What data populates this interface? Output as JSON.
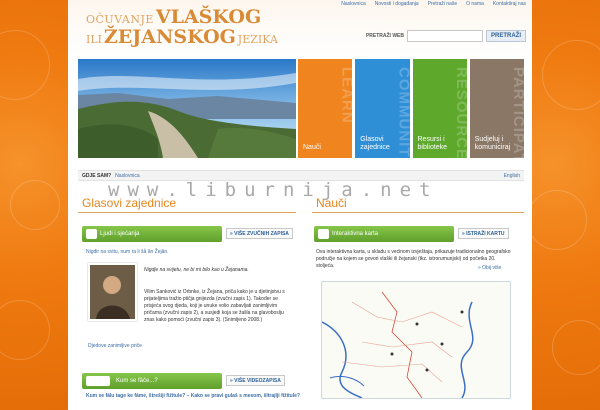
{
  "header": {
    "title_line1_small": "OČUVANJE",
    "title_line1_large": "VLAŠKOG",
    "title_line2_small1": "ILI",
    "title_line2_large": "ŽEJANSKOG",
    "title_line2_small2": "JEZIKA"
  },
  "topnav": [
    "Naslovnica",
    "Novosti i događanja",
    "Pretraži naše",
    "O nama",
    "Kontaktiraj nas"
  ],
  "search": {
    "label": "PRETRAŽI WEB",
    "button": "PRETRAŽI",
    "value": ""
  },
  "tiles": [
    {
      "label": "Nauči",
      "watermark": "LEARN",
      "color": "#f0841f"
    },
    {
      "label": "Glasovi zajednice",
      "watermark": "COMMUNITY",
      "color": "#2f8fd6"
    },
    {
      "label": "Resursi i biblioteke",
      "watermark": "RESOURCES",
      "color": "#5ea82b"
    },
    {
      "label": "Sudjeluj i komuniciraj",
      "watermark": "PARTICIPATE",
      "color": "#8a7765"
    }
  ],
  "breadcrumb": {
    "label": "GDJE SAM?",
    "link": "Naslovnica",
    "language": "English"
  },
  "watermark": "www.liburnija.net",
  "left": {
    "title": "Glasovi zajednice",
    "box1": {
      "title": "Ljudi i sjećanja",
      "more": "» VIŠE ZVUČNIH ZAPISA"
    },
    "intro": "Nigdir na svitu, num ra li šå ân Žejân.",
    "quote": "Nigdje na svijetu, ne bi mi bilo kao u Žejanama.",
    "body": "Vilim Sanković iz Orbnke, iz Žejana, priča kako je u djetinjstvu s prijateljima tražio ptičja gnijezda (zvučni zapis 1). Također se prisjeća svog djeda, koji je unuke volio zabavljati zanimljivim pričama (zvučni zapis 2), a susjedi koja se žalila na glavoboslju znas kako pomoći (zvučni zapis 3). (Snimljeno 2008.)",
    "more_link": "Djedove zanimljive priče",
    "box2": {
      "title": "Kum se fâče...?",
      "more": "» VIŠE VIDEOZAPISA"
    },
    "question": "Kum se fâlu tage ke fâme, štrešiji fižitule? – Kako se pravi gulaš s mesom, šltrajlji fižitule?"
  },
  "right": {
    "title": "Nauči",
    "box": {
      "title": "Interaktivna karta",
      "more": "» ISTRAŽI KARTU"
    },
    "body": "Ova interaktivna karta, u skladu s većinom izvještaja, prikazuje tradicionalno geografsko područje na kojem se govori vlaški ili žejanski (tkz. istrorumunjski) od početka 20. stoljeća.",
    "more_link": "» Obij više"
  }
}
